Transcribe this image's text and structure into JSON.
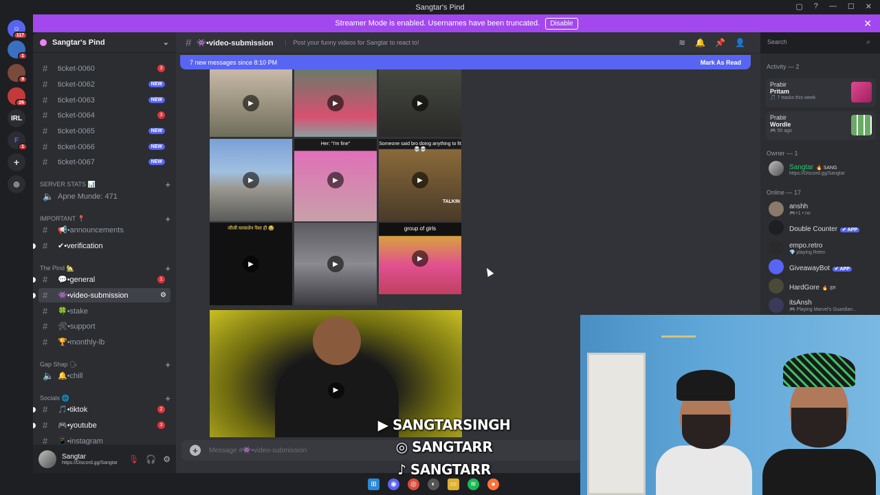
{
  "window": {
    "title": "Sangtar's Pind"
  },
  "banner": {
    "text": "Streamer Mode is enabled. Usernames have been truncated.",
    "button": "Disable"
  },
  "guild": {
    "name": "Sangtar's Pind"
  },
  "servers": [
    {
      "label": "",
      "badge": "117",
      "color": "#5865f2"
    },
    {
      "label": "",
      "badge": "1",
      "color": "#3b6fc0"
    },
    {
      "label": "",
      "badge": "9",
      "color": "#7a4a3a"
    },
    {
      "label": "",
      "badge": "26",
      "color": "#c43a3a"
    },
    {
      "label": "IRL",
      "badge": "",
      "color": "#2b2d31"
    },
    {
      "label": "F",
      "badge": "1",
      "color": "#2b2d31"
    }
  ],
  "channels": {
    "tickets": [
      {
        "name": "ticket-0060",
        "badge": "3",
        "type": "red"
      },
      {
        "name": "ticket-0062",
        "badge": "NEW",
        "type": "new"
      },
      {
        "name": "ticket-0063",
        "badge": "NEW",
        "type": "new"
      },
      {
        "name": "ticket-0064",
        "badge": "3",
        "type": "red"
      },
      {
        "name": "ticket-0065",
        "badge": "NEW",
        "type": "new"
      },
      {
        "name": "ticket-0066",
        "badge": "NEW",
        "type": "new"
      },
      {
        "name": "ticket-0067",
        "badge": "NEW",
        "type": "new"
      }
    ],
    "cat_server_stats": "SERVER STATS 📊",
    "apne_munde": "Apne Munde: 471",
    "cat_important": "IMPORTANT 📍",
    "announcements": "📢•announcements",
    "verification": "✔•verification",
    "cat_pind": "The Pind 🏡",
    "general": "💬•general",
    "general_badge": "1",
    "video_submission": "👾•video-submission",
    "stake": "🍀•stake",
    "support": "🛠•support",
    "monthly_lb": "🏆•monthly-lb",
    "cat_gapshap": "Gap Shap 🗣",
    "chill": "🔔•chill",
    "cat_socials": "Socials 🌐",
    "tiktok": "🎵•tiktok",
    "tiktok_badge": "2",
    "youtube": "🎮•youtube",
    "youtube_badge": "3",
    "instagram": "📱•instagram"
  },
  "user": {
    "name": "Sangtar",
    "status": "https://Discord.gg/Sangtar"
  },
  "chat": {
    "channel": "👾•video-submission",
    "topic": "Post your funny videos for Sangtar to react to!",
    "new_messages": "7 new messages since 8:10 PM",
    "mark_read": "Mark As Read",
    "compose_placeholder": "Message #👾•video-submission",
    "caption_1": "Her: \"I'm fine\"",
    "caption_2": "Someone said bro doing anything to fit 💀💀",
    "caption_3": "जीजी घरवालेन पैसा ही 😂",
    "caption_4": "group of girls",
    "caption_5": "TALKIN"
  },
  "search": {
    "placeholder": "Search"
  },
  "members": {
    "activity_header": "Activity — 2",
    "activities": [
      {
        "who": "Prabir",
        "what": "Pritam",
        "sub": "🎵 7 tracks this week"
      },
      {
        "who": "Prabir",
        "what": "Wordle",
        "sub": "🎮 5h ago"
      }
    ],
    "owner_header": "Owner — 1",
    "owner": {
      "name": "Sangtar",
      "tag": "🔥 SANG",
      "status": "https://Discord.gg/Sangtar"
    },
    "online_header": "Online — 17",
    "online": [
      {
        "name": "anshh",
        "status": "🎮+1 • no",
        "app": ""
      },
      {
        "name": "Double Counter",
        "status": "",
        "app": "✔ APP"
      },
      {
        "name": "empo.retro",
        "status": "💎 playing Retro",
        "app": ""
      },
      {
        "name": "GiveawayBot",
        "status": "",
        "app": "✔ APP"
      },
      {
        "name": "HardGore",
        "status": "",
        "app": "",
        "tag": "🔥 ਰਸ"
      },
      {
        "name": "itsAnsh",
        "status": "🎮 Playing Marvel's Guardian...",
        "app": ""
      }
    ]
  },
  "overlay": {
    "youtube": "SANGTARSINGH",
    "instagram": "SANGTARR",
    "tiktok": "SANGTARR"
  },
  "colors": {
    "accent": "#5865f2",
    "banner": "#a348ee",
    "danger": "#da373c"
  }
}
